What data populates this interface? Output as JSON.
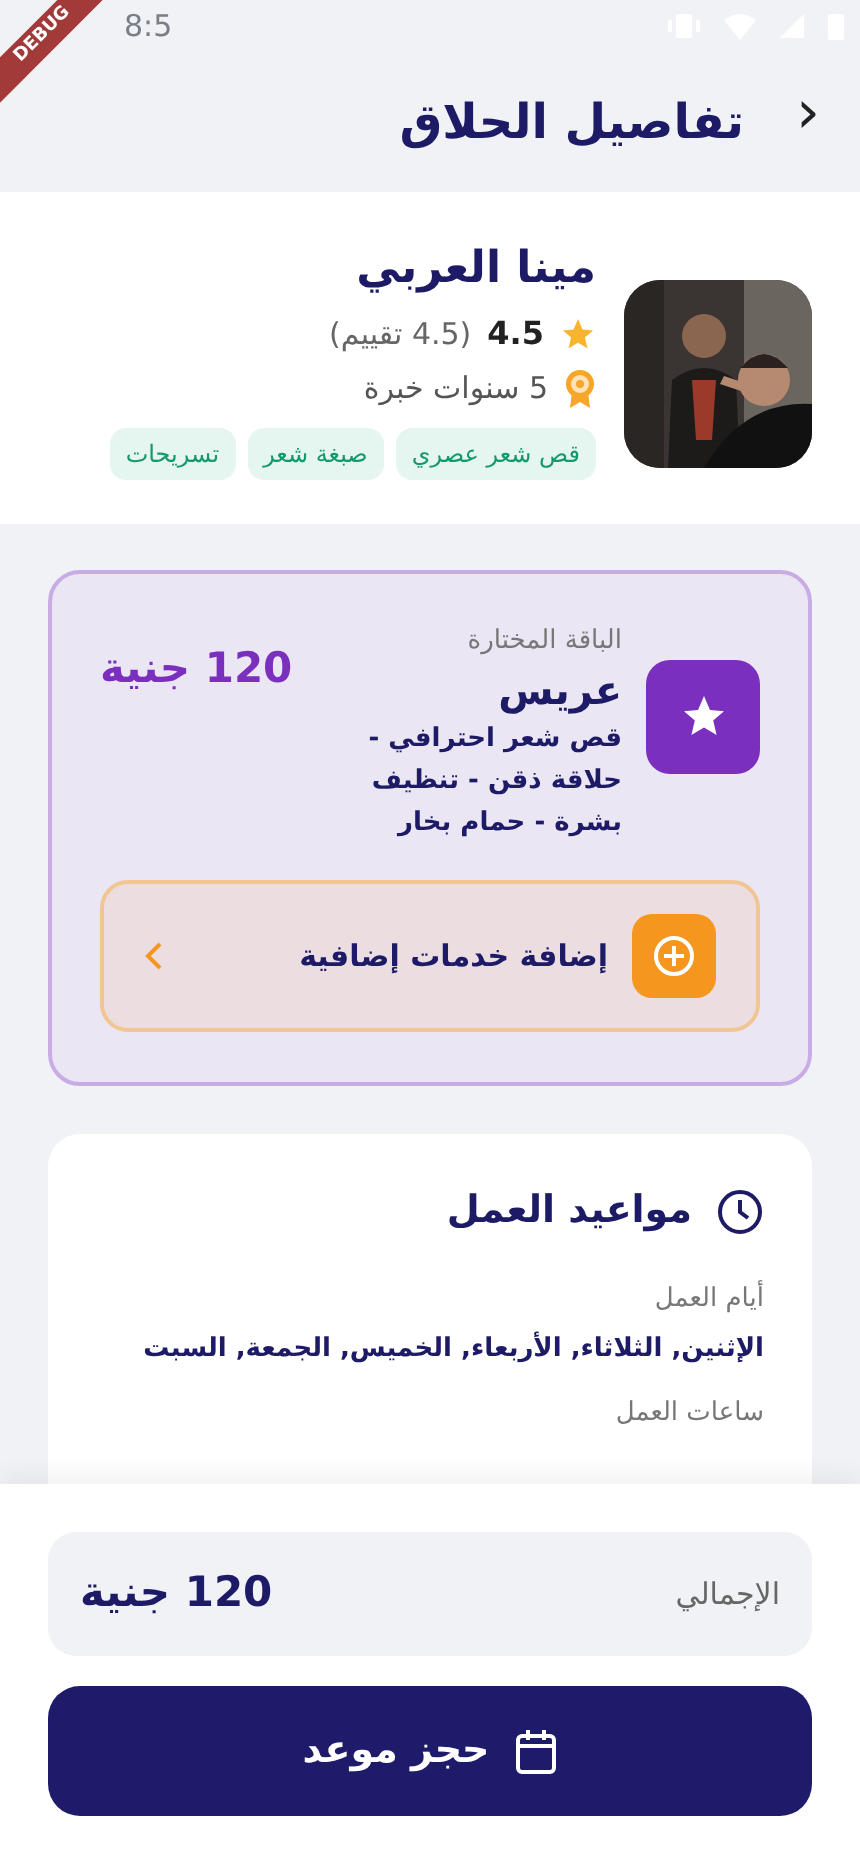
{
  "status_bar": {
    "time": "8:5"
  },
  "debug_banner": "DEBUG",
  "header": {
    "title": "تفاصيل الحلاق",
    "back": "‹"
  },
  "barber": {
    "name": "مينا العربي",
    "rating": "4.5",
    "reviews": "(4.5 تقييم)",
    "experience": "5 سنوات خبرة",
    "tags": [
      "قص شعر عصري",
      "صبغة شعر",
      "تسريحات"
    ]
  },
  "package": {
    "label": "الباقة المختارة",
    "name": "عريس",
    "description": "قص شعر احترافي - حلاقة ذقن - تنظيف بشرة - حمام بخار",
    "price": "120 جنية",
    "extras": {
      "label": "إضافة خدمات إضافية"
    }
  },
  "hours": {
    "title": "مواعيد العمل",
    "days_label": "أيام العمل",
    "days": "الإثنين, الثلاثاء, الأربعاء, الخميس, الجمعة, السبت",
    "hours_label": "ساعات العمل"
  },
  "total": {
    "label": "الإجمالي",
    "value": "120 جنية"
  },
  "book_button": {
    "label": "حجز موعد"
  }
}
